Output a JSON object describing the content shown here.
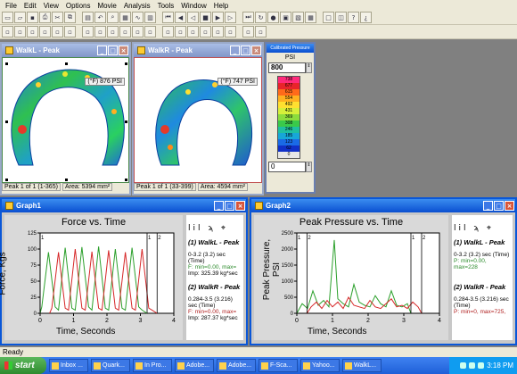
{
  "menu": [
    "File",
    "Edit",
    "View",
    "Options",
    "Movie",
    "Analysis",
    "Tools",
    "Window",
    "Help"
  ],
  "toolbar1_icons": [
    "new-icon",
    "open-icon",
    "save-icon",
    "print-icon",
    "cut-icon",
    "copy-icon",
    "paste-icon",
    "undo-icon",
    "zoom-icon",
    "grid-icon",
    "graph-icon",
    "table-icon",
    "first-frame-icon",
    "prev-frame-icon",
    "play-back-icon",
    "stop-icon",
    "play-icon",
    "next-frame-icon",
    "last-frame-icon",
    "loop-icon",
    "record-icon",
    "camera-icon",
    "film-icon",
    "tile-icon",
    "frame-icon",
    "overlay-icon",
    "help-icon",
    "about-icon"
  ],
  "toolbar2_icons": [
    "select-icon",
    "box-icon",
    "mask-icon",
    "peak-icon",
    "cof-icon",
    "trajectory-icon",
    "contour-icon",
    "3d-icon",
    "2d-icon",
    "color-icon",
    "legend-icon",
    "calibrate-icon",
    "sensor-icon",
    "rotate-icon",
    "flip-icon",
    "scale-icon",
    "grid2-icon",
    "tile2-icon",
    "window-icon",
    "close-all-icon"
  ],
  "windows": {
    "walkl": {
      "title": "WalkL - Peak",
      "peak_badge": "(°F) 876 PSI",
      "status": [
        "Peak 1 of 1 (1-365)",
        "Area: 5394 mm²"
      ]
    },
    "walkr": {
      "title": "WalkR - Peak",
      "peak_badge": "(°F) 747 PSI",
      "status": [
        "Peak 1 of 1 (33-399)",
        "Area: 4594 mm²"
      ]
    },
    "legend": {
      "title": "Calibrated Pressure",
      "unit": "PSI",
      "max_value": "800",
      "min_value": "0",
      "levels": [
        "738",
        "677",
        "615",
        "554",
        "492",
        "431",
        "369",
        "308",
        "246",
        "185",
        "123",
        "62",
        "0"
      ],
      "colors": [
        "#ff2a7a",
        "#e8242a",
        "#ff6a1a",
        "#ffb020",
        "#ffe030",
        "#d6ef3a",
        "#8cdc3c",
        "#3ac94a",
        "#1fbfa0",
        "#17a7d8",
        "#1a6ae6",
        "#1030c8",
        "#e6e6e6"
      ]
    },
    "graph1": {
      "title": "Graph1",
      "chart_title": "Force vs. Time",
      "ylabel": "Force, Kgs",
      "xlabel": "Time, Seconds",
      "side_icons": "lil ϡ ⌖",
      "side": {
        "s1_title": "(1) WalkL - Peak",
        "s1_range": "0-3.2 (3.2) sec (Time)",
        "s1_stats": "F: min=0.00, max=",
        "s1_imp": "Imp: 325.39 kg*sec",
        "s2_title": "(2) WalkR - Peak",
        "s2_range": "0.284-3.5 (3.216) sec (Time)",
        "s2_stats": "F: min=0.00, max=",
        "s2_imp": "Imp: 287.37 kg*sec"
      },
      "marker_labels": [
        "1",
        "1",
        "2"
      ]
    },
    "graph2": {
      "title": "Graph2",
      "chart_title": "Peak Pressure vs. Time",
      "ylabel": "Peak Pressure, PSI",
      "xlabel": "Time, Seconds",
      "side_icons": "lil ϡ ⌖",
      "side": {
        "s1_title": "(1) WalkL - Peak",
        "s1_range": "0-3.2 (3.2) sec (Time)",
        "s1_stats": "P: min=0.00, max=228",
        "s2_title": "(2) WalkR - Peak",
        "s2_range": "0.284-3.5 (3.216) sec (Time)",
        "s2_stats": "P: min=0, max=725,"
      },
      "marker_labels": [
        "1",
        "2",
        "1",
        "2"
      ]
    }
  },
  "chart_data": [
    {
      "type": "line",
      "title": "Force vs. Time",
      "xlabel": "Time, Seconds",
      "ylabel": "Force, Kgs",
      "xlim": [
        0,
        4
      ],
      "ylim": [
        0,
        125
      ],
      "xticks": [
        0,
        1,
        2,
        3,
        4
      ],
      "yticks": [
        0,
        25,
        50,
        75,
        100,
        125
      ],
      "series": [
        {
          "name": "WalkL - Peak",
          "color": "#2ca02c",
          "x": [
            0.0,
            0.05,
            0.25,
            0.45,
            0.55,
            0.75,
            0.95,
            1.05,
            1.25,
            1.45,
            1.55,
            1.75,
            1.95,
            2.05,
            2.25,
            2.45,
            2.55,
            2.75,
            2.95,
            3.05,
            3.2
          ],
          "y": [
            0,
            10,
            95,
            10,
            5,
            102,
            8,
            5,
            103,
            10,
            5,
            104,
            8,
            5,
            100,
            8,
            5,
            102,
            10,
            5,
            0
          ]
        },
        {
          "name": "WalkR - Peak",
          "color": "#d62728",
          "x": [
            0.284,
            0.35,
            0.55,
            0.75,
            0.85,
            1.05,
            1.25,
            1.35,
            1.55,
            1.75,
            1.85,
            2.05,
            2.25,
            2.35,
            2.55,
            2.75,
            2.85,
            3.05,
            3.25,
            3.35,
            3.5
          ],
          "y": [
            0,
            8,
            95,
            8,
            5,
            100,
            8,
            5,
            96,
            8,
            5,
            98,
            8,
            5,
            95,
            8,
            5,
            100,
            8,
            5,
            0
          ]
        }
      ]
    },
    {
      "type": "line",
      "title": "Peak Pressure vs. Time",
      "xlabel": "Time, Seconds",
      "ylabel": "Peak Pressure, PSI",
      "xlim": [
        0,
        4
      ],
      "ylim": [
        0,
        2500
      ],
      "xticks": [
        0,
        1,
        2,
        3,
        4
      ],
      "yticks": [
        0,
        500,
        1000,
        1500,
        2000,
        2500
      ],
      "series": [
        {
          "name": "WalkL - Peak",
          "color": "#2ca02c",
          "x": [
            0.0,
            0.15,
            0.3,
            0.45,
            0.6,
            0.75,
            0.9,
            1.05,
            1.15,
            1.3,
            1.45,
            1.6,
            1.75,
            1.9,
            2.05,
            2.2,
            2.35,
            2.5,
            2.65,
            2.8,
            2.95,
            3.1,
            3.2
          ],
          "y": [
            0,
            300,
            150,
            700,
            250,
            400,
            200,
            2280,
            450,
            300,
            200,
            900,
            350,
            250,
            200,
            550,
            300,
            200,
            700,
            250,
            200,
            300,
            0
          ]
        },
        {
          "name": "WalkR - Peak",
          "color": "#d62728",
          "x": [
            0.284,
            0.4,
            0.55,
            0.7,
            0.85,
            1.0,
            1.15,
            1.3,
            1.45,
            1.6,
            1.75,
            1.9,
            2.05,
            2.2,
            2.35,
            2.5,
            2.65,
            2.8,
            2.95,
            3.1,
            3.25,
            3.4,
            3.5
          ],
          "y": [
            0,
            200,
            350,
            150,
            400,
            200,
            350,
            150,
            500,
            250,
            200,
            150,
            400,
            200,
            150,
            300,
            450,
            200,
            250,
            150,
            350,
            200,
            0
          ]
        }
      ]
    }
  ],
  "statusbar": "Ready",
  "taskbar": {
    "start": "start",
    "tasks": [
      "Inbox ...",
      "Quark...",
      "In Pro...",
      "Adobe...",
      "Adobe...",
      "F-Sca...",
      "Yahoo...",
      "WalkL..."
    ],
    "clock": "3:18 PM"
  }
}
